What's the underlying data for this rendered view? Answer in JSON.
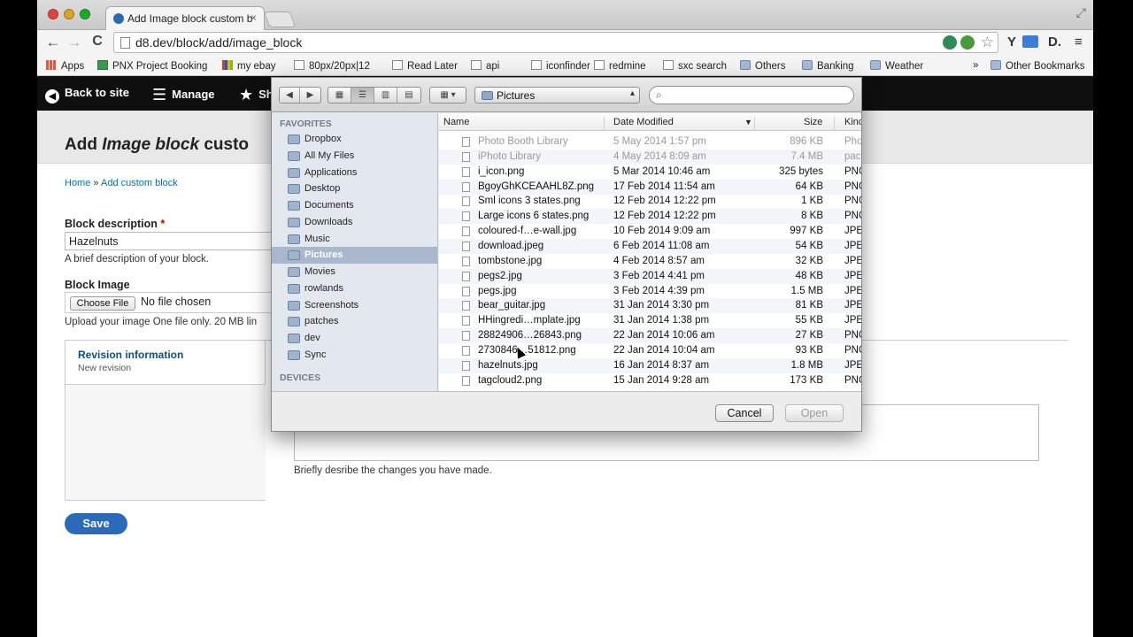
{
  "browser": {
    "tab_title": "Add Image block custom b",
    "tab_close": "×",
    "url": "d8.dev/block/add/image_block",
    "back": "←",
    "forward": "→",
    "reload": "C",
    "bookmark_star": "☆",
    "ext_y": "Y",
    "ext_d": "D.",
    "menu": "≡",
    "fullscreen": "⤢"
  },
  "bookmarks": {
    "items": [
      {
        "label": "Apps",
        "icon": "grid"
      },
      {
        "label": "PNX Project Booking",
        "icon": "sheet"
      },
      {
        "label": "my ebay",
        "icon": "ebay"
      },
      {
        "label": "80px/20px|12",
        "icon": "page"
      },
      {
        "label": "Read Later",
        "icon": "page"
      },
      {
        "label": "api",
        "icon": "page"
      },
      {
        "label": "iconfinder",
        "icon": "page"
      },
      {
        "label": "redmine",
        "icon": "page"
      },
      {
        "label": "sxc search",
        "icon": "page"
      },
      {
        "label": "Others",
        "icon": "folder"
      },
      {
        "label": "Banking",
        "icon": "folder"
      },
      {
        "label": "Weather",
        "icon": "folder"
      }
    ],
    "overflow": "»",
    "other": "Other Bookmarks"
  },
  "adminbar": {
    "back_to_site": "Back to site",
    "manage": "Manage",
    "shortcuts": "Sh"
  },
  "page": {
    "title_prefix": "Add ",
    "title_em": "Image block",
    "title_suffix": " custo",
    "breadcrumb_home": "Home",
    "breadcrumb_sep": "»",
    "breadcrumb_current": "Add custom block",
    "block_description_label": "Block description",
    "required_mark": "*",
    "block_description_value": "Hazelnuts",
    "block_description_help": "A brief description of your block.",
    "block_image_label": "Block Image",
    "choose_file": "Choose File",
    "no_file": "No file chosen",
    "upload_help": "Upload your image One file only. 20 MB lin",
    "revision_title": "Revision information",
    "revision_sub": "New revision",
    "revision_help": "Briefly desribe the changes you have made.",
    "save": "Save"
  },
  "dialog": {
    "location": "Pictures",
    "sidebar_favorites": "FAVORITES",
    "sidebar_devices": "DEVICES",
    "sidebar_items": [
      {
        "label": "Dropbox",
        "selected": false
      },
      {
        "label": "All My Files",
        "selected": false
      },
      {
        "label": "Applications",
        "selected": false
      },
      {
        "label": "Desktop",
        "selected": false
      },
      {
        "label": "Documents",
        "selected": false
      },
      {
        "label": "Downloads",
        "selected": false
      },
      {
        "label": "Music",
        "selected": false
      },
      {
        "label": "Pictures",
        "selected": true
      },
      {
        "label": "Movies",
        "selected": false
      },
      {
        "label": "rowlands",
        "selected": false
      },
      {
        "label": "Screenshots",
        "selected": false
      },
      {
        "label": "patches",
        "selected": false
      },
      {
        "label": "dev",
        "selected": false
      },
      {
        "label": "Sync",
        "selected": false
      }
    ],
    "columns": {
      "name": "Name",
      "date": "Date Modified",
      "size": "Size",
      "kind": "Kind"
    },
    "files": [
      {
        "name": "Photo Booth Library",
        "date": "5 May 2014 1:57 pm",
        "size": "896 KB",
        "kind": "Phot",
        "dim": true
      },
      {
        "name": "iPhoto Library",
        "date": "4 May 2014 8:09 am",
        "size": "7.4 MB",
        "kind": "pack",
        "dim": true
      },
      {
        "name": "i_icon.png",
        "date": "5 Mar 2014 10:46 am",
        "size": "325 bytes",
        "kind": "PNG",
        "dim": false
      },
      {
        "name": "BgoyGhKCEAAHL8Z.png",
        "date": "17 Feb 2014 11:54 am",
        "size": "64 KB",
        "kind": "PNG",
        "dim": false
      },
      {
        "name": "Sml icons 3 states.png",
        "date": "12 Feb 2014 12:22 pm",
        "size": "1 KB",
        "kind": "PNG",
        "dim": false
      },
      {
        "name": "Large icons 6 states.png",
        "date": "12 Feb 2014 12:22 pm",
        "size": "8 KB",
        "kind": "PNG",
        "dim": false
      },
      {
        "name": "coloured-f…e-wall.jpg",
        "date": "10 Feb 2014 9:09 am",
        "size": "997 KB",
        "kind": "JPEC",
        "dim": false
      },
      {
        "name": "download.jpeg",
        "date": "6 Feb 2014 11:08 am",
        "size": "54 KB",
        "kind": "JPEC",
        "dim": false
      },
      {
        "name": "tombstone.jpg",
        "date": "4 Feb 2014 8:57 am",
        "size": "32 KB",
        "kind": "JPEC",
        "dim": false
      },
      {
        "name": "pegs2.jpg",
        "date": "3 Feb 2014 4:41 pm",
        "size": "48 KB",
        "kind": "JPEC",
        "dim": false
      },
      {
        "name": "pegs.jpg",
        "date": "3 Feb 2014 4:39 pm",
        "size": "1.5 MB",
        "kind": "JPEC",
        "dim": false
      },
      {
        "name": "bear_guitar.jpg",
        "date": "31 Jan 2014 3:30 pm",
        "size": "81 KB",
        "kind": "JPEC",
        "dim": false
      },
      {
        "name": "HHingredi…mplate.jpg",
        "date": "31 Jan 2014 1:38 pm",
        "size": "55 KB",
        "kind": "JPEC",
        "dim": false
      },
      {
        "name": "28824906…26843.png",
        "date": "22 Jan 2014 10:06 am",
        "size": "27 KB",
        "kind": "PNG",
        "dim": false
      },
      {
        "name": "2730846…51812.png",
        "date": "22 Jan 2014 10:04 am",
        "size": "93 KB",
        "kind": "PNG",
        "dim": false
      },
      {
        "name": "hazelnuts.jpg",
        "date": "16 Jan 2014 8:37 am",
        "size": "1.8 MB",
        "kind": "JPEC",
        "dim": false
      },
      {
        "name": "tagcloud2.png",
        "date": "15 Jan 2014 9:28 am",
        "size": "173 KB",
        "kind": "PNG",
        "dim": false
      }
    ],
    "cancel": "Cancel",
    "open": "Open"
  }
}
